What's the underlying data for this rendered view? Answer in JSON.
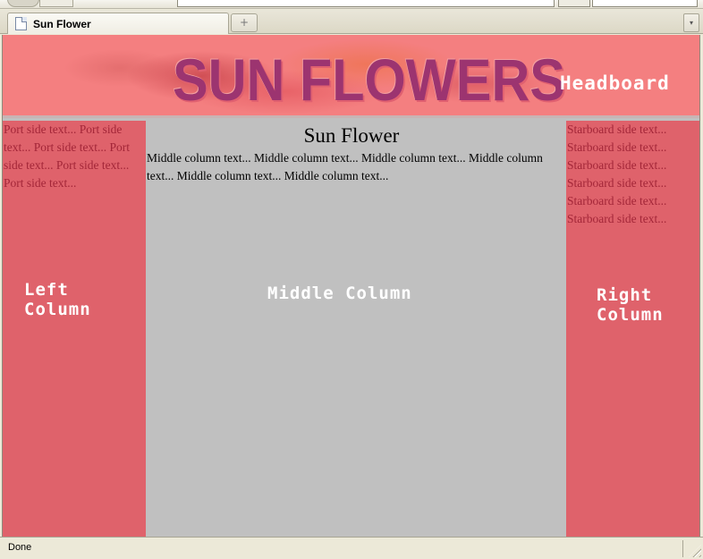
{
  "browser": {
    "tab_title": "Sun Flower",
    "new_tab_symbol": "+",
    "tab_list_symbol": "▾",
    "status": "Done"
  },
  "page": {
    "banner_text": "SUN FLOWERS",
    "headboard_label": "Headboard",
    "left": {
      "text": "Port side text... Port side text... Port side text... Port side text... Port side text... Port side text...",
      "label_line1": "Left",
      "label_line2": "Column"
    },
    "middle": {
      "title": "Sun Flower",
      "text": "Middle column text... Middle column text... Middle column text... Middle column text... Middle column text... Middle column text...",
      "label": "Middle Column"
    },
    "right": {
      "lines": [
        "Starboard side text...",
        "Starboard side text...",
        "Starboard side text...",
        "Starboard side text...",
        "Starboard side text...",
        "Starboard side text..."
      ],
      "label_line1": "Right",
      "label_line2": "Column"
    }
  },
  "colors": {
    "headboard_bg": "#f47f80",
    "side_bg": "#df626b",
    "middle_bg": "#c0c0c0",
    "banner_text": "#9c3470",
    "side_text": "#a32638"
  },
  "icons": {
    "tab": "page-icon",
    "resize": "resize-grip-icon"
  }
}
